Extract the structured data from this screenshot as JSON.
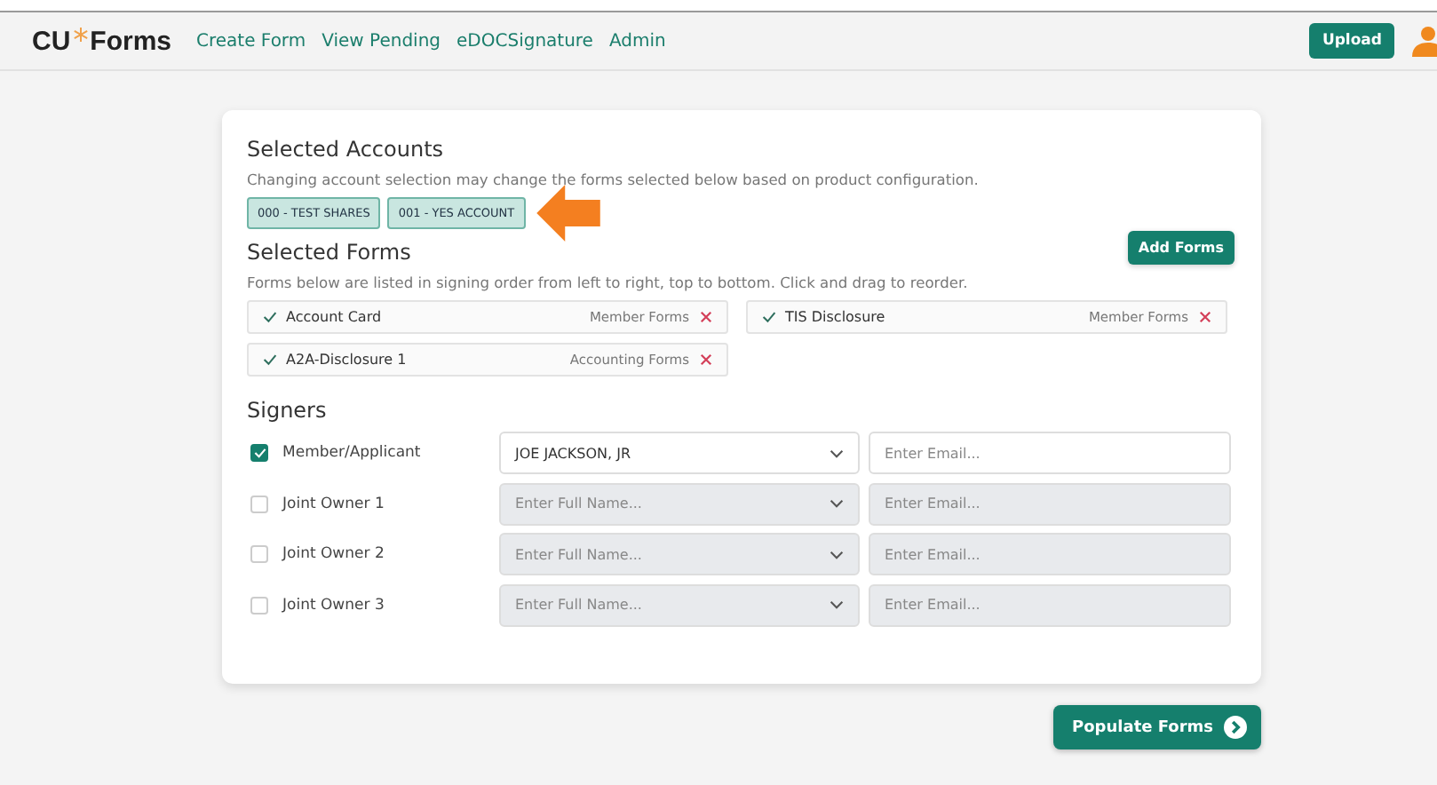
{
  "header": {
    "logo": {
      "left": "CU",
      "right": "Forms"
    },
    "nav": [
      "Create Form",
      "View Pending",
      "eDOCSignature",
      "Admin"
    ],
    "upload": "Upload"
  },
  "accounts": {
    "title": "Selected Accounts",
    "note": "Changing account selection may change the forms selected below based on product configuration.",
    "tags": [
      "000 - TEST SHARES",
      "001 - YES ACCOUNT"
    ]
  },
  "forms": {
    "title": "Selected Forms",
    "add": "Add Forms",
    "note": "Forms below are listed in signing order from left to right, top to bottom. Click and drag to reorder.",
    "items": [
      {
        "name": "Account Card",
        "category": "Member Forms"
      },
      {
        "name": "TIS Disclosure",
        "category": "Member Forms"
      },
      {
        "name": "A2A-Disclosure 1",
        "category": "Accounting Forms"
      }
    ]
  },
  "signers": {
    "title": "Signers",
    "rows": [
      {
        "label": "Member/Applicant",
        "checked": true,
        "name": "JOE JACKSON, JR",
        "email_placeholder": "Enter Email..."
      },
      {
        "label": "Joint Owner 1",
        "checked": false,
        "name_placeholder": "Enter Full Name...",
        "email_placeholder": "Enter Email..."
      },
      {
        "label": "Joint Owner 2",
        "checked": false,
        "name_placeholder": "Enter Full Name...",
        "email_placeholder": "Enter Email..."
      },
      {
        "label": "Joint Owner 3",
        "checked": false,
        "name_placeholder": "Enter Full Name...",
        "email_placeholder": "Enter Email..."
      }
    ]
  },
  "populate": "Populate Forms"
}
